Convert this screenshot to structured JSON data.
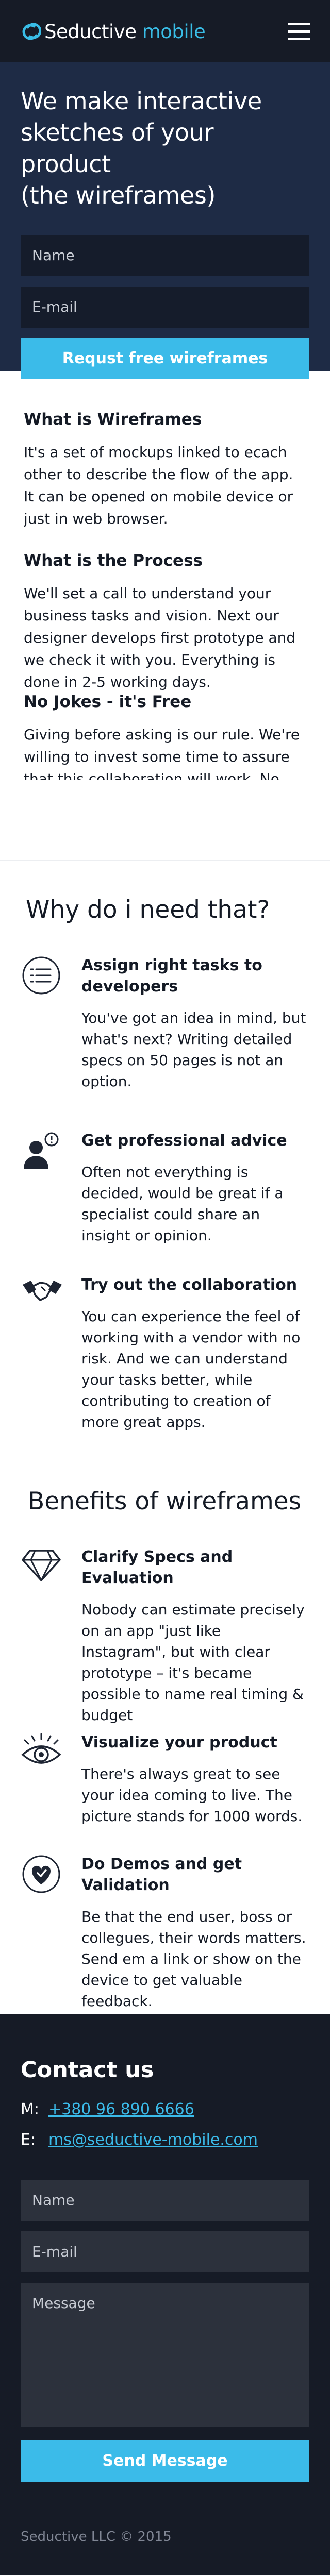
{
  "header": {
    "logo_main": "Seductive",
    "logo_accent": " mobile",
    "menu_icon": "hamburger-icon"
  },
  "hero": {
    "title": "We make interactive\nsketches of your product\n(the wireframes)",
    "name_placeholder": "Name",
    "email_placeholder": "E-mail",
    "cta_label": "Requst free wireframes"
  },
  "info": [
    {
      "title": "What is Wireframes",
      "text": "It's a set of mockups linked to ecach other to describe the flow of the app. It can be opened on mobile device or just in web browser."
    },
    {
      "title": "What is the Process",
      "text": "We'll set a call to understand your business tasks and vision. Next our designer develops first prototype and we check it with you. Everything is done in 2-5 working days."
    },
    {
      "title": "No Jokes - it's Free",
      "text": "Giving before asking is our rule. We're willing to invest some time to assure that this collaboration will work. No"
    }
  ],
  "why": {
    "title": "Why do i need that?",
    "items": [
      {
        "icon": "checklist-icon",
        "title": "Assign right tasks to developers",
        "text": "You've got an idea in mind, but what's next?  Writing detailed specs on 50 pages is not an option."
      },
      {
        "icon": "advisor-icon",
        "title": "Get professional advice",
        "text": "Often not everything is decided, would be great if a specialist could share an insight or opinion."
      },
      {
        "icon": "handshake-icon",
        "title": "Try out the collaboration",
        "text": "You can experience the feel of working with a vendor with no risk. And we can understand your tasks better, while contributing to creation of more great apps."
      }
    ]
  },
  "benefits": {
    "title": "Benefits of wireframes",
    "items": [
      {
        "icon": "diamond-icon",
        "title": "Clarify Specs and Evaluation",
        "text": "Nobody can estimate precisely on an app \"just like Instagram\", but with clear prototype – it's became possible to name real timing & budget"
      },
      {
        "icon": "eye-icon",
        "title": "Visualize your product",
        "text": "There's always great to see your idea coming to live. The picture stands for 1000 words."
      },
      {
        "icon": "heart-check-icon",
        "title": "Do Demos and get Validation",
        "text": "Be that the end user, boss or collegues, their words matters. Send em a link or show on the device to get valuable feedback."
      }
    ]
  },
  "contact": {
    "title": "Contact us",
    "phone_label": "M:",
    "phone": "+380 96 890 6666",
    "email_label": "E:",
    "email": "ms@seductive-mobile.com",
    "name_placeholder": "Name",
    "email_placeholder": "E-mail",
    "message_placeholder": "Message",
    "send_label": "Send Message"
  },
  "footer": {
    "copyright": "Seductive LLC © 2015"
  },
  "colors": {
    "accent": "#3bbbe9",
    "hero_bg": "#1e2b45",
    "dark_bg": "#161b26"
  }
}
